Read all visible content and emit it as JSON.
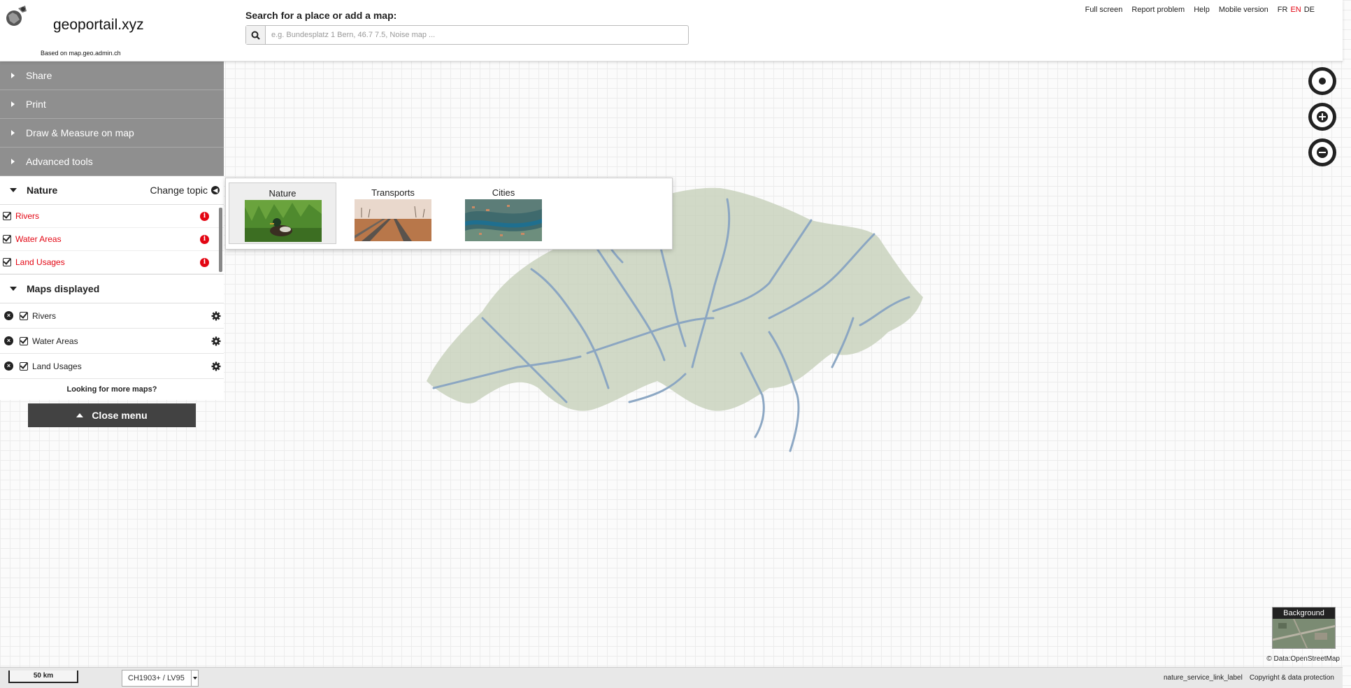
{
  "header": {
    "title": "geoportail.xyz",
    "based_on": "Based on map.geo.admin.ch",
    "search_label": "Search for a place or add a map:",
    "search_placeholder": "e.g. Bundesplatz 1 Bern, 46.7 7.5, Noise map ...",
    "search_value": "",
    "links": [
      "Full screen",
      "Report problem",
      "Help",
      "Mobile version"
    ],
    "languages": [
      "FR",
      "EN",
      "DE"
    ],
    "active_language": "EN"
  },
  "menu": {
    "items": [
      "Share",
      "Print",
      "Draw & Measure on map",
      "Advanced tools"
    ],
    "topic_title": "Nature",
    "change_topic": "Change topic",
    "topic_layers": [
      "Rivers",
      "Water Areas",
      "Land Usages"
    ],
    "maps_displayed_title": "Maps displayed",
    "maps_displayed": [
      "Rivers",
      "Water Areas",
      "Land Usages"
    ],
    "more_maps": "Looking for more maps?",
    "close_menu": "Close menu"
  },
  "topics": [
    {
      "name": "Nature",
      "active": true
    },
    {
      "name": "Transports",
      "active": false
    },
    {
      "name": "Cities",
      "active": false
    }
  ],
  "background": {
    "label": "Background",
    "credit": "© Data:OpenStreetMap"
  },
  "footer": {
    "scale": "50 km",
    "projection": "CH1903+ / LV95",
    "links": [
      "nature_service_link_label",
      "Copyright & data protection"
    ]
  },
  "colors": {
    "accent_red": "#e30613",
    "menu_gray": "#8f8f8f",
    "river_blue": "#88a4c2",
    "landuse_green": "#c9d2bd"
  }
}
